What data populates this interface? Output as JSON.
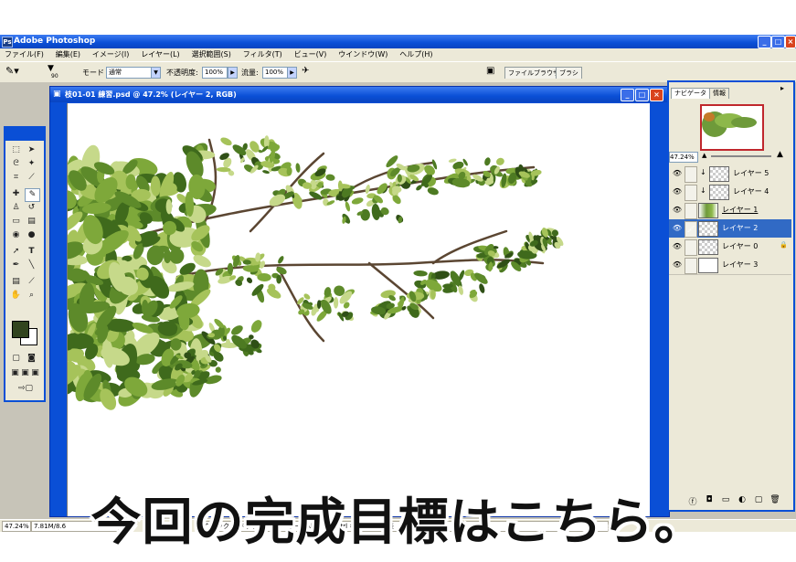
{
  "app": {
    "title": "Adobe Photoshop",
    "logo": "Ps"
  },
  "window_buttons": {
    "minimize": "_",
    "maximize": "□",
    "close": "×"
  },
  "menu": [
    "ファイル(F)",
    "編集(E)",
    "イメージ(I)",
    "レイヤー(L)",
    "選択範囲(S)",
    "フィルタ(T)",
    "ビュー(V)",
    "ウインドウ(W)",
    "ヘルプ(H)"
  ],
  "options": {
    "brush_size": "90",
    "mode_label": "モード",
    "mode_value": "通常",
    "opacity_label": "不透明度:",
    "opacity_value": "100%",
    "flow_label": "流量:",
    "flow_value": "100%"
  },
  "palette_well": {
    "tab1": "ファイルブラウザ",
    "tab2": "ブラシ"
  },
  "document": {
    "title": "枝01-01 練習.psd @ 47.2% (レイヤー 2, RGB)"
  },
  "navigator": {
    "tab_navigator": "ナビゲータ",
    "tab_info": "情報",
    "zoom": "47.24%"
  },
  "layers": [
    {
      "name": "レイヤー 5",
      "thumb": "checker",
      "clip": true,
      "selected": false,
      "link": "",
      "underline": false,
      "lock": false
    },
    {
      "name": "レイヤー 4",
      "thumb": "checker",
      "clip": true,
      "selected": false,
      "link": "",
      "underline": false,
      "lock": false
    },
    {
      "name": "レイヤー 1",
      "thumb": "leaf",
      "clip": false,
      "selected": false,
      "link": "",
      "underline": true,
      "lock": false
    },
    {
      "name": "レイヤー 2",
      "thumb": "checker",
      "clip": false,
      "selected": true,
      "link": "🖌",
      "underline": false,
      "lock": false
    },
    {
      "name": "レイヤー 0",
      "thumb": "checker",
      "clip": false,
      "selected": false,
      "link": "",
      "underline": false,
      "lock": true
    },
    {
      "name": "レイヤー 3",
      "thumb": "white",
      "clip": false,
      "selected": false,
      "link": "",
      "underline": false,
      "lock": false
    }
  ],
  "statusbar": {
    "zoom": "47.24%",
    "doc_size": "7.81M/8.6",
    "hint": "クリック & ドラッグ…Shift キー、Alt キー、Ctrl キーで機能拡張"
  },
  "subtitle": "今回の完成目標はこちら。",
  "colors": {
    "xp_blue": "#0a4fd6",
    "panel": "#ece9d8",
    "foreground_swatch": "#31441e",
    "background_swatch": "#ffffff",
    "selected_layer": "#316ac5"
  },
  "icons": {
    "eye": "👁",
    "clip": "↓",
    "lock": "🔒"
  }
}
